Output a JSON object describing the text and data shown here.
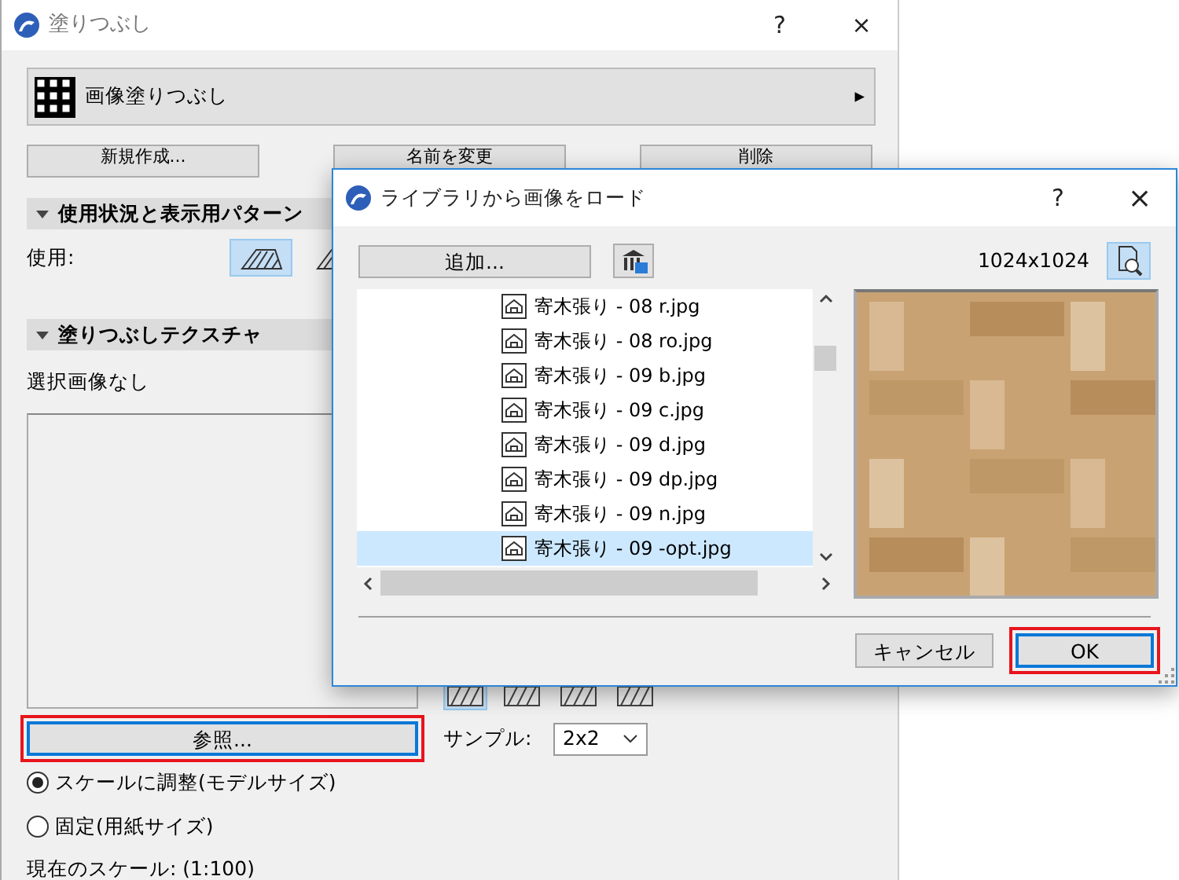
{
  "main_window": {
    "title": "塗りつぶし",
    "help": "?",
    "close": "×"
  },
  "fill_type": {
    "label": "画像塗りつぶし",
    "arrow": "▸"
  },
  "buttons": [
    "新規作成...",
    "名前を変更",
    "削除"
  ],
  "usage_section": {
    "title": "使用状況と表示用パターン",
    "expanded": true,
    "label": "使用:",
    "icons": [
      {
        "selected": true
      },
      {
        "selected": false
      }
    ]
  },
  "texture_section": {
    "title": "塗りつぶしテクスチャ",
    "expanded": true,
    "status": "選択画像なし",
    "browse_button": {
      "label": "参照...",
      "highlighted": true
    }
  },
  "pattern_icons": [
    {
      "selected": true
    },
    {
      "selected": false
    },
    {
      "selected": false
    },
    {
      "selected": false
    }
  ],
  "sample": {
    "label": "サンプル:",
    "value": "2x2"
  },
  "scale_options": [
    {
      "label": "スケールに調整(モデルサイズ)",
      "selected": true
    },
    {
      "label": "固定(用紙サイズ)",
      "selected": false
    }
  ],
  "current_scale": "現在のスケール: (1:100)",
  "dialog": {
    "title": "ライブラリから画像をロード",
    "help": "?",
    "close": "×",
    "add_button": "追加...",
    "resolution": "1024x1024",
    "preview_info": {
      "selected": true
    },
    "files": [
      {
        "name": "寄木張り - 08 r.jpg",
        "selected": false
      },
      {
        "name": "寄木張り - 08 ro.jpg",
        "selected": false
      },
      {
        "name": "寄木張り - 09 b.jpg",
        "selected": false
      },
      {
        "name": "寄木張り - 09 c.jpg",
        "selected": false
      },
      {
        "name": "寄木張り - 09 d.jpg",
        "selected": false
      },
      {
        "name": "寄木張り - 09 dp.jpg",
        "selected": false
      },
      {
        "name": "寄木張り - 09 n.jpg",
        "selected": false
      },
      {
        "name": "寄木張り - 09 -opt.jpg",
        "selected": true
      }
    ],
    "buttons": [
      {
        "label": "キャンセル",
        "highlighted": false
      },
      {
        "label": "OK",
        "highlighted": true
      }
    ]
  }
}
